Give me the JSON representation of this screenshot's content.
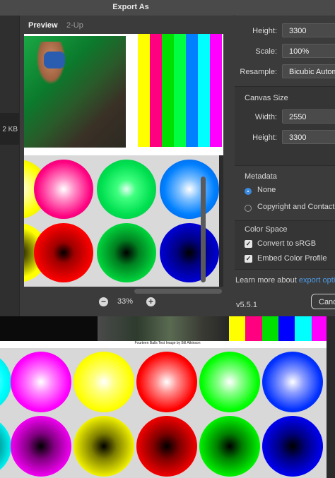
{
  "dialog": {
    "title": "Export As",
    "file_size": "2 KB",
    "tabs": [
      {
        "label": "Preview"
      },
      {
        "label": "2-Up"
      }
    ],
    "zoom": "33%",
    "settings": {
      "height_label": "Height:",
      "height_value": "3300",
      "scale_label": "Scale:",
      "scale_value": "100%",
      "resample_label": "Resample:",
      "resample_value": "Bicubic Automa",
      "canvas_size_heading": "Canvas Size",
      "canvas_width_label": "Width:",
      "canvas_width_value": "2550",
      "canvas_height_label": "Height:",
      "canvas_height_value": "3300",
      "metadata_heading": "Metadata",
      "metadata_options": [
        {
          "label": "None",
          "selected": true
        },
        {
          "label": "Copyright and Contact Inf",
          "selected": false
        }
      ],
      "color_space_heading": "Color Space",
      "color_space_options": [
        {
          "label": "Convert to sRGB",
          "checked": true
        },
        {
          "label": "Embed Color Profile",
          "checked": true
        }
      ],
      "learn_more_text": "Learn more about",
      "learn_more_link": "export options",
      "version": "v5.5.1",
      "cancel_label": "Canc"
    }
  },
  "background_document": {
    "caption": "Fourteen Balls Test Image by Bill Atkinson",
    "preview_caption_small": "Fourteen Balls Test Image by Bill Atkinson"
  },
  "colors": {
    "accent_link": "#4d9be6",
    "radio_selected": "#3b8be0",
    "dialog_bg": "#3b3b3b"
  },
  "icons": {
    "zoom_out": "minus-circle-icon",
    "zoom_in": "plus-circle-icon",
    "radio": "radio-icon",
    "checkbox": "checkbox-icon"
  }
}
